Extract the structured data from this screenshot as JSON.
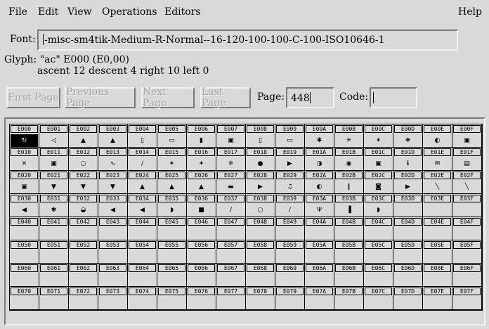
{
  "menu": {
    "file": "File",
    "edit": "Edit",
    "view": "View",
    "operations": "Operations",
    "editors": "Editors",
    "help": "Help"
  },
  "font": {
    "label": "Font:",
    "value": "-misc-sm4tik-Medium-R-Normal--16-120-100-100-C-100-ISO10646-1"
  },
  "glyph_info": {
    "line1": "Glyph: \"ac\" E000 (E0,00)",
    "line2": "ascent 12 descent 4 right 10 left 0"
  },
  "buttons": {
    "first_page": "First Page",
    "previous_page": "Previous Page",
    "next_page": "Next Page",
    "last_page": "Last Page"
  },
  "page": {
    "label": "Page:",
    "value": "448"
  },
  "code": {
    "label": "Code:",
    "value": ""
  },
  "grid": {
    "selected_code": "E000",
    "rows": [
      {
        "codes": [
          "E000",
          "E001",
          "E002",
          "E003",
          "E004",
          "E005",
          "E006",
          "E007",
          "E008",
          "E009",
          "E00A",
          "E00B",
          "E00C",
          "E00D",
          "E00E",
          "E00F"
        ],
        "glyphs": [
          "↻",
          "◁",
          "▲",
          "▲",
          "▯",
          "▭",
          "▮",
          "▣",
          "▯",
          "▭",
          "✱",
          "✳",
          "✶",
          "❖",
          "◐",
          "▣"
        ]
      },
      {
        "codes": [
          "E010",
          "E011",
          "E012",
          "E013",
          "E014",
          "E015",
          "E016",
          "E017",
          "E018",
          "E019",
          "E01A",
          "E01B",
          "E01C",
          "E01D",
          "E01E",
          "E01F"
        ],
        "glyphs": [
          "✕",
          "▣",
          "○",
          "∿",
          "∕",
          "✶",
          "✶",
          "✵",
          "●",
          "▶",
          "◑",
          "◉",
          "▣",
          "ℹ",
          "✉",
          "▤"
        ]
      },
      {
        "codes": [
          "E020",
          "E021",
          "E022",
          "E023",
          "E024",
          "E025",
          "E026",
          "E027",
          "E028",
          "E029",
          "E02A",
          "E02B",
          "E02C",
          "E02D",
          "E02E",
          "E02F"
        ],
        "glyphs": [
          "▣",
          "▼",
          "▼",
          "▼",
          "▲",
          "▲",
          "▲",
          "▬",
          "▶",
          "♫",
          "◐",
          "❙",
          "◙",
          "▶",
          "╲",
          "╲"
        ]
      },
      {
        "codes": [
          "E030",
          "E031",
          "E032",
          "E033",
          "E034",
          "E035",
          "E036",
          "E037",
          "E038",
          "E039",
          "E03A",
          "E03B",
          "E03C",
          "E03D",
          "E03E",
          "E03F"
        ],
        "glyphs": [
          "◀",
          "✱",
          "◒",
          "◀",
          "◀",
          "◗",
          "■",
          "∕",
          "○",
          "∕",
          "Ψ",
          "▐",
          "◗",
          "",
          "",
          ""
        ]
      },
      {
        "codes": [
          "E040",
          "E041",
          "E042",
          "E043",
          "E044",
          "E045",
          "E046",
          "E047",
          "E048",
          "E049",
          "E04A",
          "E04B",
          "E04C",
          "E04D",
          "E04E",
          "E04F"
        ],
        "glyphs": [
          "",
          "",
          "",
          "",
          "",
          "",
          "",
          "",
          "",
          "",
          "",
          "",
          "",
          "",
          "",
          ""
        ]
      },
      {
        "codes": [
          "E050",
          "E051",
          "E052",
          "E053",
          "E054",
          "E055",
          "E056",
          "E057",
          "E058",
          "E059",
          "E05A",
          "E05B",
          "E05C",
          "E05D",
          "E05E",
          "E05F"
        ],
        "glyphs": [
          "",
          "",
          "",
          "",
          "",
          "",
          "",
          "",
          "",
          "",
          "",
          "",
          "",
          "",
          "",
          ""
        ]
      },
      {
        "codes": [
          "E060",
          "E061",
          "E062",
          "E063",
          "E064",
          "E065",
          "E066",
          "E067",
          "E068",
          "E069",
          "E06A",
          "E06B",
          "E06C",
          "E06D",
          "E06E",
          "E06F"
        ],
        "glyphs": [
          "",
          "",
          "",
          "",
          "",
          "",
          "",
          "",
          "",
          "",
          "",
          "",
          "",
          "",
          "",
          ""
        ]
      },
      {
        "codes": [
          "E070",
          "E071",
          "E072",
          "E073",
          "E074",
          "E075",
          "E076",
          "E077",
          "E078",
          "E079",
          "E07A",
          "E07B",
          "E07C",
          "E07D",
          "E07E",
          "E07F"
        ],
        "glyphs": [
          "",
          "",
          "",
          "",
          "",
          "",
          "",
          "",
          "",
          "",
          "",
          "",
          "",
          "",
          "",
          ""
        ]
      }
    ]
  }
}
